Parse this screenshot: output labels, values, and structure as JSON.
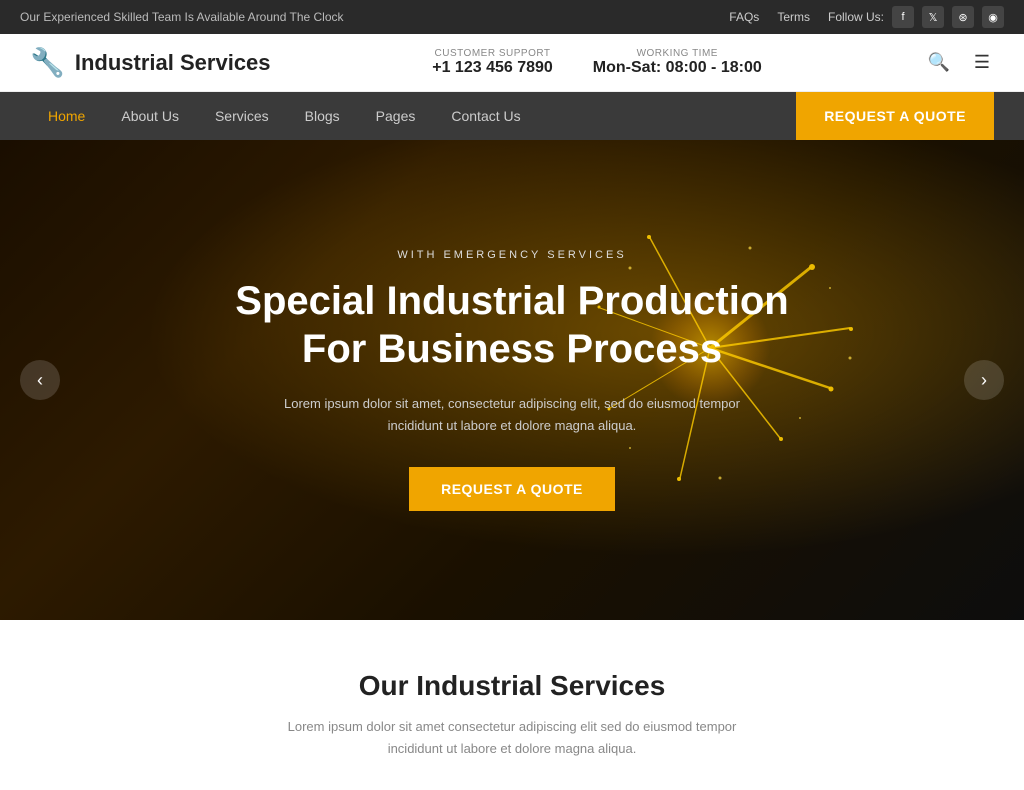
{
  "topbar": {
    "announcement": "Our Experienced Skilled Team Is Available Around The Clock",
    "faqs": "FAQs",
    "terms": "Terms",
    "follow_us": "Follow Us:"
  },
  "header": {
    "logo_text": "Industrial Services",
    "customer_support_label": "CUSTOMER SUPPORT",
    "customer_support_phone": "+1 123 456 7890",
    "working_time_label": "WORKING TIME",
    "working_time_value": "Mon-Sat: 08:00 - 18:00"
  },
  "navbar": {
    "items": [
      {
        "label": "Home",
        "active": true
      },
      {
        "label": "About Us",
        "active": false
      },
      {
        "label": "Services",
        "active": false
      },
      {
        "label": "Blogs",
        "active": false
      },
      {
        "label": "Pages",
        "active": false
      },
      {
        "label": "Contact Us",
        "active": false
      }
    ],
    "quote_btn": "Request A Quote"
  },
  "hero": {
    "subtitle": "WITH EMERGENCY SERVICES",
    "title": "Special Industrial Production\nFor Business Process",
    "description": "Lorem ipsum dolor sit amet, consectetur adipiscing elit, sed do eiusmod tempor\nincididunt ut labore et dolore magna aliqua.",
    "cta_btn": "Request A Quote",
    "arrow_left": "‹",
    "arrow_right": "›"
  },
  "services": {
    "title": "Our Industrial Services",
    "description": "Lorem ipsum dolor sit amet consectetur adipiscing elit sed do eiusmod tempor incididunt ut labore et dolore magna aliqua."
  },
  "colors": {
    "accent": "#f0a500",
    "dark_bg": "#3a3a3a",
    "topbar_bg": "#2a2a2a"
  }
}
